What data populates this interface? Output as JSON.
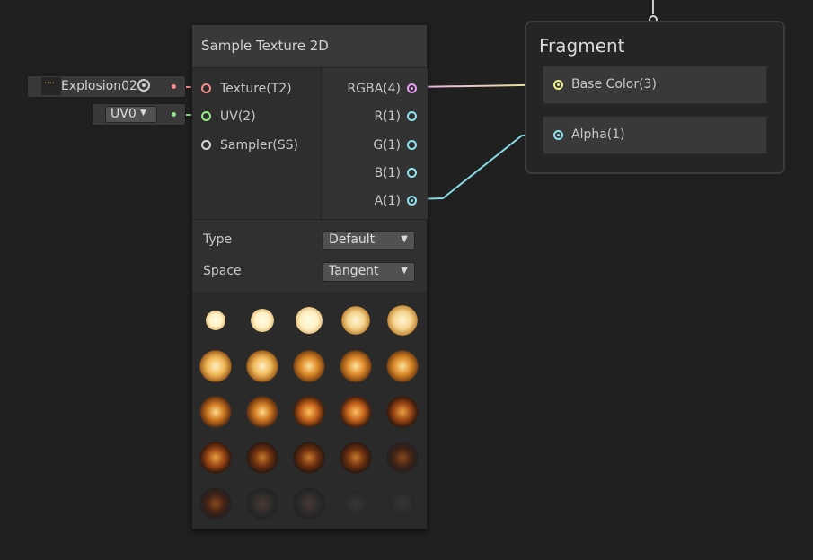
{
  "inline_inputs": {
    "texture": {
      "value": "Explosion02",
      "thumb_label": "••••"
    },
    "uv": {
      "value": "UV0",
      "arrow": "▼"
    }
  },
  "node": {
    "title": "Sample Texture 2D",
    "inputs": [
      {
        "label": "Texture(T2)",
        "color": "#f18b8b"
      },
      {
        "label": "UV(2)",
        "color": "#94ee84"
      },
      {
        "label": "Sampler(SS)",
        "color": "#d8d8d8"
      }
    ],
    "outputs": [
      {
        "label": "RGBA(4)",
        "color": "#e39cf0"
      },
      {
        "label": "R(1)",
        "color": "#8ee3ef"
      },
      {
        "label": "G(1)",
        "color": "#8ee3ef"
      },
      {
        "label": "B(1)",
        "color": "#8ee3ef"
      },
      {
        "label": "A(1)",
        "color": "#8ee3ef"
      }
    ],
    "settings": {
      "type_label": "Type",
      "type_value": "Default",
      "space_label": "Space",
      "space_value": "Tangent",
      "arrow": "▼"
    }
  },
  "fragment": {
    "title": "Fragment",
    "fields": [
      {
        "label": "Base Color(3)",
        "color": "#eef28a"
      },
      {
        "label": "Alpha(1)",
        "color": "#8ee3ef"
      }
    ]
  },
  "wire_colors": {
    "texture": "#f08a8a",
    "uv": "#8fe089",
    "rgba_start": "#eab0ec",
    "rgba_end": "#eaea8a",
    "alpha": "#86d9e3"
  }
}
